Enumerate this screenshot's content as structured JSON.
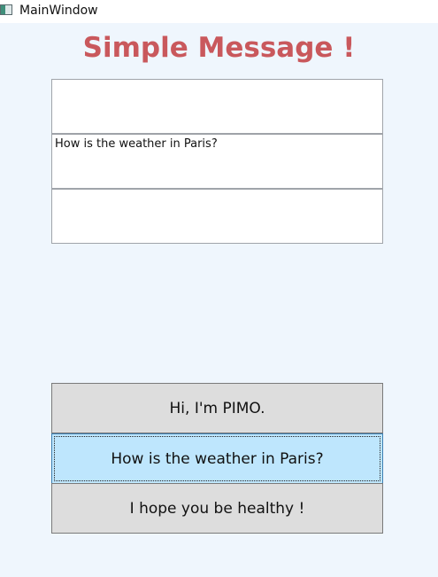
{
  "window": {
    "title": "MainWindow",
    "icon": "app-window-icon"
  },
  "heading": "Simple Message !",
  "messages": [
    {
      "text": ""
    },
    {
      "text": "How is the weather in Paris?"
    },
    {
      "text": ""
    }
  ],
  "choices": [
    {
      "label": "Hi, I'm PIMO.",
      "selected": false
    },
    {
      "label": "How is the weather in Paris?",
      "selected": true
    },
    {
      "label": "I hope you be healthy !",
      "selected": false
    }
  ],
  "colors": {
    "heading": "#c9585c",
    "background": "#eff6fd",
    "button": "#dddddd",
    "button_selected": "#bee6fd"
  }
}
